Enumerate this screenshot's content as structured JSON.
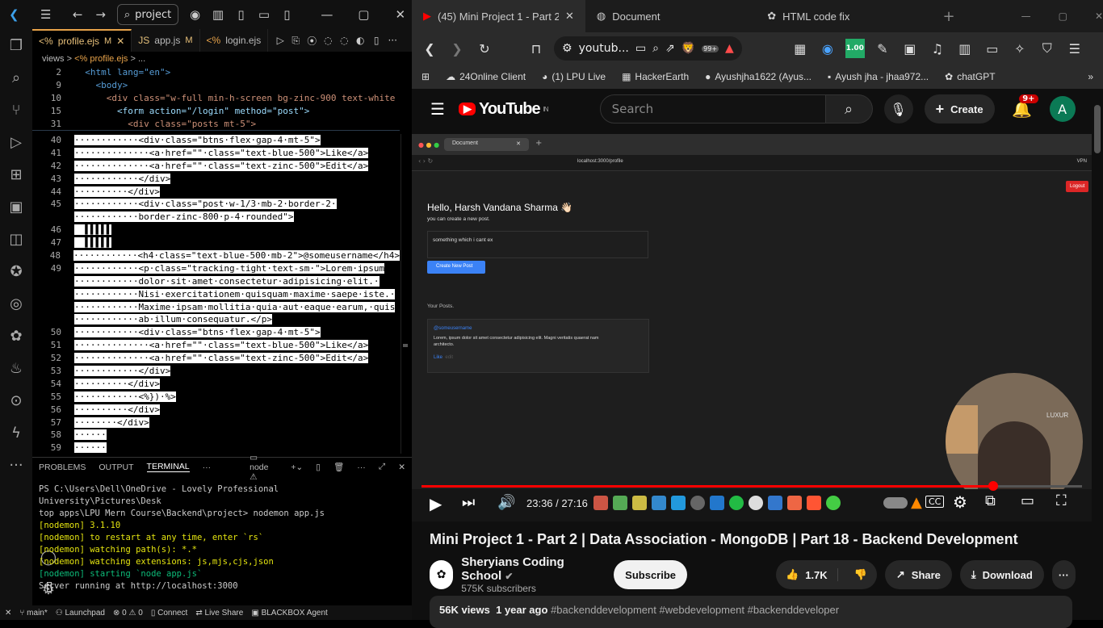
{
  "vscode": {
    "search": "project",
    "tabs": [
      {
        "name": "profile.ejs",
        "mod": "M"
      },
      {
        "name": "app.js",
        "mod": "M"
      },
      {
        "name": "login.ejs",
        "mod": ""
      }
    ],
    "breadcrumb": [
      "views",
      ">",
      "<% profile.ejs",
      ">",
      "..."
    ],
    "sticky": [
      {
        "n": "2",
        "t": "  <html lang=\"en\">"
      },
      {
        "n": "9",
        "t": "    <body>"
      },
      {
        "n": "10",
        "t": "      <div class=\"w-full min-h-screen bg-zinc-900 text-white"
      },
      {
        "n": "15",
        "t": "        <form action=\"/login\" method=\"post\">"
      },
      {
        "n": "31",
        "t": "          <div class=\"posts mt-5\">"
      }
    ],
    "lines": [
      {
        "n": "40",
        "t": "············<div·class=\"btns·flex·gap-4·mt-5\">"
      },
      {
        "n": "41",
        "t": "··············<a·href=\"\"·class=\"text-blue-500\">Like</a>"
      },
      {
        "n": "42",
        "t": "··············<a·href=\"\"·class=\"text-zinc-500\">Edit</a>"
      },
      {
        "n": "43",
        "t": "············</div>"
      },
      {
        "n": "44",
        "t": "··········</div>"
      },
      {
        "n": "45",
        "t": "············<div·class=\"post·w-1/3·mb-2·border-2·"
      },
      {
        "n": "",
        "t": "············border-zinc-800·p-4·rounded\">"
      },
      {
        "n": "46",
        "t": "  ▌▌▌▌▌"
      },
      {
        "n": "47",
        "t": "  ▌▌▌▌▌"
      },
      {
        "n": "48",
        "t": "············<h4·class=\"text-blue-500·mb-2\">@someusername</h4>"
      },
      {
        "n": "49",
        "t": "············<p·class=\"tracking-tight·text-sm·\">Lorem·ipsum"
      },
      {
        "n": "",
        "t": "············dolor·sit·amet·consectetur·adipisicing·elit.·"
      },
      {
        "n": "",
        "t": "············Nisi·exercitationem·quisquam·maxime·saepe·iste.·"
      },
      {
        "n": "",
        "t": "············Maxime·ipsam·mollitia·quia·aut·eaque·earum,·quis"
      },
      {
        "n": "",
        "t": "············ab·illum·consequatur.</p>"
      },
      {
        "n": "50",
        "t": "············<div·class=\"btns·flex·gap-4·mt-5\">"
      },
      {
        "n": "51",
        "t": "··············<a·href=\"\"·class=\"text-blue-500\">Like</a>"
      },
      {
        "n": "52",
        "t": "··············<a·href=\"\"·class=\"text-zinc-500\">Edit</a>"
      },
      {
        "n": "53",
        "t": "············</div>"
      },
      {
        "n": "54",
        "t": "··········</div>"
      },
      {
        "n": "55",
        "t": "············<%})·%>"
      },
      {
        "n": "56",
        "t": "··········</div>"
      },
      {
        "n": "57",
        "t": "········</div>"
      },
      {
        "n": "58",
        "t": "······"
      },
      {
        "n": "59",
        "t": "······"
      }
    ],
    "panel_tabs": [
      "PROBLEMS",
      "OUTPUT",
      "TERMINAL",
      "···"
    ],
    "panel_shell": "node",
    "terminal": [
      {
        "c": "",
        "t": "PS C:\\Users\\Dell\\OneDrive - Lovely Professional University\\Pictures\\Desk"
      },
      {
        "c": "",
        "t": "top apps\\LPU Mern Course\\Backend\\project> nodemon app.js"
      },
      {
        "c": "ylw",
        "t": "[nodemon] 3.1.10"
      },
      {
        "c": "ylw",
        "t": "[nodemon] to restart at any time, enter `rs`"
      },
      {
        "c": "ylw",
        "t": "[nodemon] watching path(s): *.*"
      },
      {
        "c": "ylw",
        "t": "[nodemon] watching extensions: js,mjs,cjs,json"
      },
      {
        "c": "grn",
        "t": "[nodemon] starting `node app.js`"
      },
      {
        "c": "",
        "t": "Server running at http://localhost:3000"
      }
    ],
    "status": [
      "main*",
      "Launchpad",
      "⊗ 0 ⚠ 0",
      "Connect",
      "Live Share",
      "BLACKBOX Agent"
    ]
  },
  "browser": {
    "tabs": [
      "(45) Mini Project 1 - Part 2",
      "Document",
      "HTML code fix"
    ],
    "url": "youtub...",
    "badge": "99+",
    "ext_badge": "1.00",
    "bookmarks": [
      "24Online Client",
      "(1) LPU Live",
      "HackerEarth",
      "Ayushjha1622 (Ayus...",
      "Ayush jha - jhaa972...",
      "chatGPT"
    ]
  },
  "youtube": {
    "logo": "YouTube",
    "region": "IN",
    "search_placeholder": "Search",
    "create": "Create",
    "notif": "9+",
    "avatar": "A",
    "time": "23:36 / 27:16",
    "progress": 0.865,
    "title": "Mini Project 1 - Part 2 | Data Association - MongoDB | Part 18 - Backend Development",
    "channel": "Sheryians Coding School",
    "subs": "575K subscribers",
    "subscribe": "Subscribe",
    "likes": "1.7K",
    "share": "Share",
    "download": "Download",
    "views": "56K views",
    "age": "1 year ago",
    "tags": "#backenddevelopment #webdevelopment #backenddeveloper"
  },
  "inner": {
    "tab": "Document",
    "url": "localhost:3000/profile",
    "vpn": "VPN",
    "logout": "Logout",
    "hello": "Hello, Harsh Vandana Sharma 👋🏻",
    "sub": "you can create a new post.",
    "textarea": "something which i cant ex",
    "button": "Create New Post",
    "your_posts": "Your Posts.",
    "post_user": "@someusername",
    "post_body": "Lorem, ipsum dolor sit amet consectetur adipisicing elit. Magni veritatis quaerat nam architecto.",
    "like": "Like",
    "edit": "edit",
    "cam_brand": "LUXUR"
  }
}
